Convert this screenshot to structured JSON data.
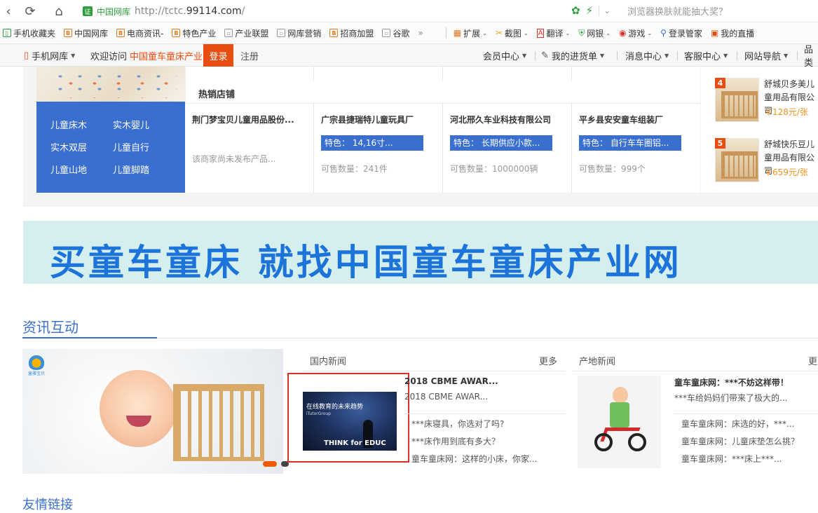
{
  "browser": {
    "site_badge": "证",
    "site_name": "中国网库",
    "url_prefix": "http://tctc.",
    "url_domain": "99114.com",
    "url_suffix": "/",
    "promo": "浏览器换肤就能抽大奖？"
  },
  "bookmarks": [
    {
      "label": "手机收藏夹",
      "icon": "phone-icon"
    },
    {
      "label": "中国网库",
      "icon": "b-icon"
    },
    {
      "label": "电商资讯-",
      "icon": "b-icon"
    },
    {
      "label": "特色产业",
      "icon": "b-icon"
    },
    {
      "label": "产业联盟",
      "icon": "doc-icon"
    },
    {
      "label": "网库营销",
      "icon": "doc-icon"
    },
    {
      "label": "招商加盟",
      "icon": "b-icon"
    },
    {
      "label": "谷歌",
      "icon": "doc-icon"
    }
  ],
  "bookmarks_more": "»",
  "tools": [
    {
      "label": "扩展"
    },
    {
      "label": "截图"
    },
    {
      "label": "翻译"
    },
    {
      "label": "网银"
    },
    {
      "label": "游戏"
    },
    {
      "label": "登录管家"
    },
    {
      "label": "我的直播"
    }
  ],
  "topbar": {
    "mobile": "手机网库",
    "welcome_prefix": "欢迎访问",
    "welcome_site": "中国童车童床产业网",
    "welcome_suffix": "！",
    "login": "登录",
    "register": "注册",
    "menus": [
      "会员中心",
      "我的进货单",
      "消息中心",
      "客服中心",
      "网站导航"
    ],
    "menu_last": "品类"
  },
  "shop": {
    "title": "热销店铺",
    "categories": [
      "儿童床木",
      "实木婴儿",
      "实木双层",
      "儿童自行",
      "儿童山地",
      "儿童脚踏"
    ],
    "cards": [
      {
        "name": "荆门梦宝贝儿童用品股份...",
        "feature": "",
        "note": "该商家尚未发布产品...",
        "count": ""
      },
      {
        "name": "广宗县捷瑞特儿童玩具厂",
        "feature": "特色： 14,16寸...",
        "note": "",
        "count": "可售数量：241件"
      },
      {
        "name": "河北邢久车业科技有限公司",
        "feature": "特色： 长期供应小款...",
        "note": "",
        "count": "可售数量：1000000辆"
      },
      {
        "name": "平乡县安安童车组装厂",
        "feature": "特色： 自行车车圈铝...",
        "note": "",
        "count": "可售数量：999个"
      }
    ]
  },
  "ranking": [
    {
      "num": "4",
      "name": "舒城贝多美儿童用品有限公司",
      "price": "￥128元/张"
    },
    {
      "num": "5",
      "name": "舒城快乐豆儿童用品有限公司",
      "price": "￥659元/张"
    }
  ],
  "banner": {
    "text": "买童车童床  就找中国童车童床产业网"
  },
  "news": {
    "heading": "资讯互动",
    "promo_logo_text": "童雅宝贝",
    "domestic": {
      "title": "国内新闻",
      "more": "更多",
      "image_line1": "在线教育的未来趋势",
      "image_line2": "iTutorGroup",
      "image_bottom": "THINK for EDUC",
      "head_title": "2018 CBME AWAR...",
      "head_sub": "2018 CBME AWAR...",
      "links": [
        "***床寝具，你选对了吗?",
        "***床作用到底有多大？",
        "童车童床网：这样的小床，你家..."
      ]
    },
    "local": {
      "title": "产地新闻",
      "more": "更",
      "head_title": "童车童床网：***不妨这样带！",
      "head_sub": "***车给妈妈们带来了极大的...",
      "links": [
        "童车童床网：床选的好，***...",
        "童车童床网：儿童床垫怎么挑？",
        "童车童床网：***床上***..."
      ]
    }
  },
  "bottom_heading": "友情链接"
}
